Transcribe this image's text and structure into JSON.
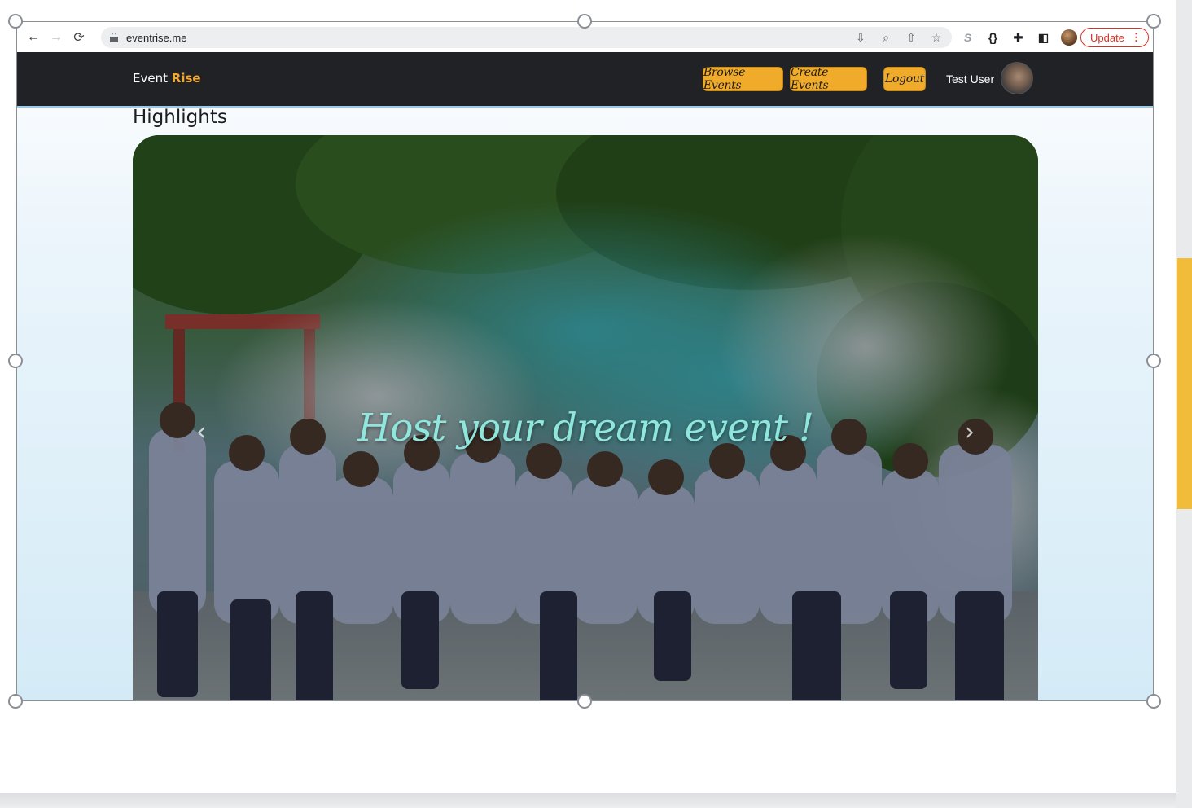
{
  "browser": {
    "url": "eventrise.me",
    "update_label": "Update",
    "nav": {
      "back": "←",
      "forward": "→",
      "reload": "⟳"
    },
    "omnibox_icons": [
      "install-app-icon",
      "zoom-icon",
      "share-icon",
      "bookmark-star-icon"
    ],
    "extension_icons": [
      "s-extension-icon",
      "json-viewer-icon",
      "extensions-puzzle-icon",
      "side-panel-icon",
      "profile-avatar"
    ]
  },
  "site": {
    "brand": {
      "part1": "Event",
      "part2": "Rise",
      "accent": "#f0a830"
    },
    "nav_buttons": [
      "Browse Events",
      "Create Events",
      "Logout"
    ],
    "user_name": "Test User",
    "nav_background": "#202226",
    "button_color": "#f1ab2b"
  },
  "highlights": {
    "title": "Highlights",
    "slide_caption": "Host your dream event !",
    "caption_color": "#8ee6dd"
  }
}
